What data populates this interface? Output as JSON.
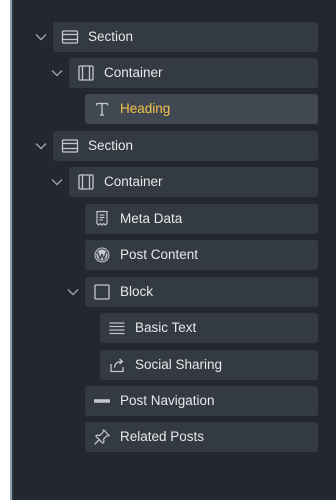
{
  "colors": {
    "background": "#23272e",
    "row": "#343a42",
    "row_selected": "#414852",
    "text": "#e6e8ea",
    "text_selected": "#f1c24b",
    "icon": "#c3c8ce"
  },
  "tree": {
    "items": [
      {
        "label": "Section",
        "icon": "section-icon",
        "expanded": true
      },
      {
        "label": "Container",
        "icon": "container-icon",
        "expanded": true
      },
      {
        "label": "Heading",
        "icon": "heading-icon",
        "selected": true
      },
      {
        "label": "Section",
        "icon": "section-icon",
        "expanded": true
      },
      {
        "label": "Container",
        "icon": "container-icon",
        "expanded": true
      },
      {
        "label": "Meta Data",
        "icon": "meta-data-icon"
      },
      {
        "label": "Post Content",
        "icon": "wordpress-icon"
      },
      {
        "label": "Block",
        "icon": "block-icon",
        "expanded": true
      },
      {
        "label": "Basic Text",
        "icon": "text-lines-icon"
      },
      {
        "label": "Social Sharing",
        "icon": "share-icon"
      },
      {
        "label": "Post Navigation",
        "icon": "post-navigation-icon"
      },
      {
        "label": "Related Posts",
        "icon": "pin-icon"
      }
    ]
  }
}
